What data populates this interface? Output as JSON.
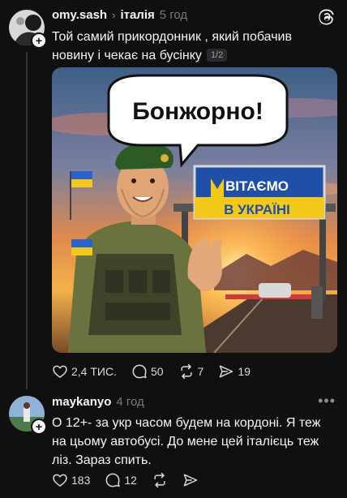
{
  "post": {
    "username": "omy.sash",
    "topic": "італія",
    "time": "5 год",
    "text": "Той самий прикордонник , який побачив новину і чекає на бусінку",
    "pager": "1/2",
    "media": {
      "speech_bubble": "Бонжорно!",
      "sign_line1": "ВІТАЄМО",
      "sign_line2": "В УКРАЇНІ"
    },
    "likes": "2,4 ТИС.",
    "comments": "50",
    "reposts": "7",
    "shares": "19"
  },
  "reply": {
    "username": "maykanyo",
    "time": "4 год",
    "text": "О 12+- за укр часом будем на кордоні. Я теж на цьому автобусі. До мене цей італієць теж ліз. Зараз спить.",
    "likes": "183",
    "comments": "12"
  },
  "icons": {
    "threads_logo": "threads-logo-icon",
    "like": "heart-icon",
    "comment": "comment-bubble-icon",
    "repost": "repost-icon",
    "share": "send-icon",
    "more": "more-dots-icon",
    "follow": "plus-icon"
  },
  "colors": {
    "background": "#101010",
    "text_primary": "#f3f5f7",
    "text_secondary": "#777a7e"
  }
}
